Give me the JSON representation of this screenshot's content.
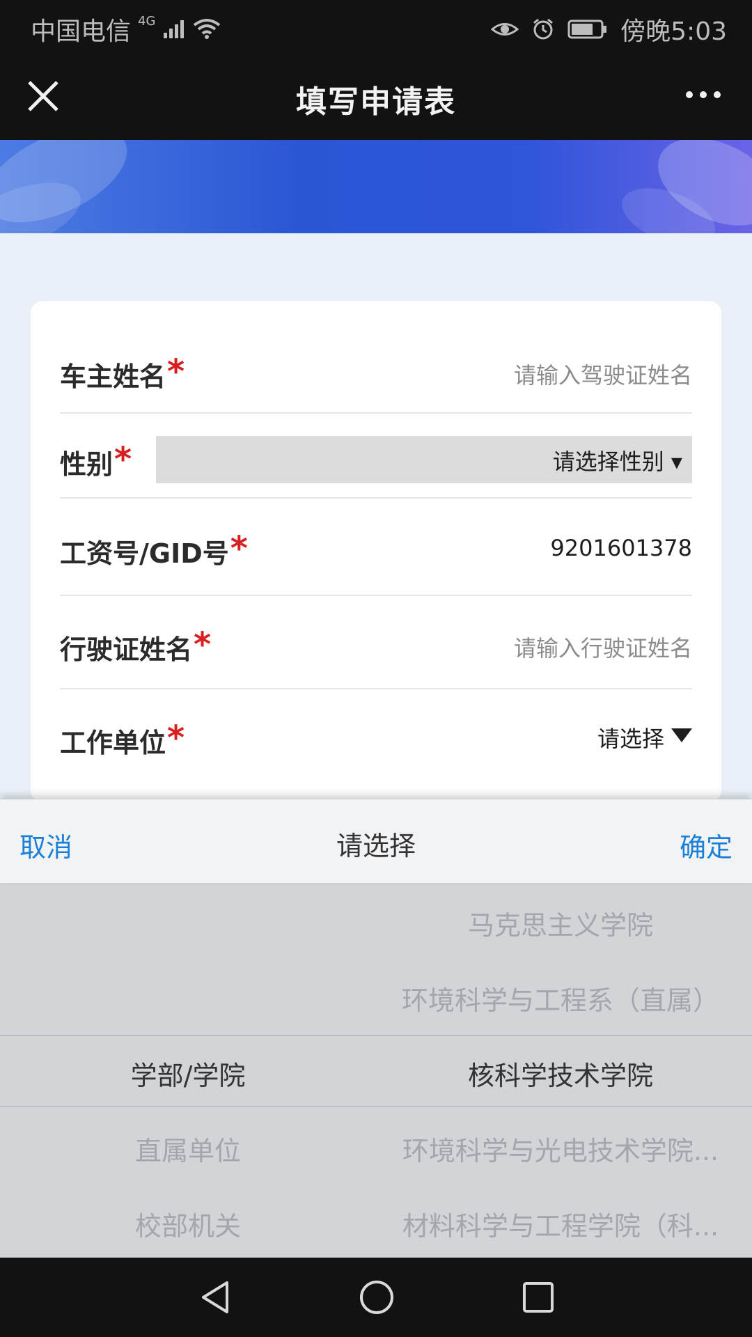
{
  "status_bar": {
    "carrier": "中国电信",
    "network": "4G",
    "time": "傍晚5:03"
  },
  "header": {
    "title": "填写申请表"
  },
  "form": {
    "fields": [
      {
        "label": "车主姓名",
        "placeholder": "请输入驾驶证姓名"
      },
      {
        "label": "性别",
        "select_value": "请选择性别 ▾"
      },
      {
        "label": "工资号/GID号",
        "value": "9201601378"
      },
      {
        "label": "行驶证姓名",
        "placeholder": "请输入行驶证姓名"
      },
      {
        "label": "工作单位",
        "select_value": "请选择"
      }
    ],
    "required_mark": "*"
  },
  "picker": {
    "cancel": "取消",
    "title": "请选择",
    "confirm": "确定",
    "left_column": {
      "selected": "学部/学院",
      "below": [
        "直属单位",
        "校部机关"
      ]
    },
    "right_column": {
      "above": [
        "马克思主义学院",
        "环境科学与工程系（直属）"
      ],
      "selected": "核科学技术学院",
      "below": [
        "环境科学与光电技术学院...",
        "材料科学与工程学院（科..."
      ]
    }
  }
}
